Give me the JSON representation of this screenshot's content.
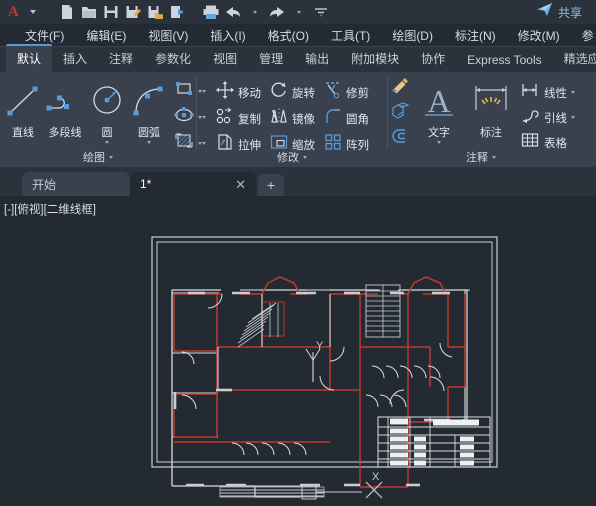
{
  "quick_access": {
    "logo": "A",
    "icons": [
      {
        "name": "app-menu-dropdown",
        "glyph": "caret"
      },
      {
        "name": "new-file-icon",
        "glyph": "page"
      },
      {
        "name": "open-folder-icon",
        "glyph": "folder"
      },
      {
        "name": "save-icon",
        "glyph": "floppy"
      },
      {
        "name": "save-as-icon",
        "glyph": "floppy-pencil"
      },
      {
        "name": "save-copy-icon",
        "glyph": "floppy-folder"
      },
      {
        "name": "export-icon",
        "glyph": "export"
      },
      {
        "name": "print-icon",
        "glyph": "printer"
      },
      {
        "name": "undo-icon",
        "glyph": "arrow-left"
      },
      {
        "name": "undo-dropdown-icon",
        "glyph": "caret"
      },
      {
        "name": "redo-icon",
        "glyph": "arrow-right"
      },
      {
        "name": "redo-dropdown-icon",
        "glyph": "caret"
      },
      {
        "name": "customize-qat-icon",
        "glyph": "caret-wide"
      }
    ],
    "share_label": "共享",
    "share_icon": "send-plane-icon"
  },
  "menubar": {
    "items": [
      {
        "label": "文件(F)",
        "name": "menu-file"
      },
      {
        "label": "编辑(E)",
        "name": "menu-edit"
      },
      {
        "label": "视图(V)",
        "name": "menu-view"
      },
      {
        "label": "插入(I)",
        "name": "menu-insert"
      },
      {
        "label": "格式(O)",
        "name": "menu-format"
      },
      {
        "label": "工具(T)",
        "name": "menu-tools"
      },
      {
        "label": "绘图(D)",
        "name": "menu-draw"
      },
      {
        "label": "标注(N)",
        "name": "menu-dimension"
      },
      {
        "label": "修改(M)",
        "name": "menu-modify"
      },
      {
        "label": "参",
        "name": "menu-parametric-truncated"
      }
    ]
  },
  "ribbon_tabs": {
    "items": [
      {
        "label": "默认",
        "name": "ribbon-tab-home",
        "active": true
      },
      {
        "label": "插入",
        "name": "ribbon-tab-insert",
        "active": false
      },
      {
        "label": "注释",
        "name": "ribbon-tab-annotate",
        "active": false
      },
      {
        "label": "参数化",
        "name": "ribbon-tab-parametric",
        "active": false
      },
      {
        "label": "视图",
        "name": "ribbon-tab-view",
        "active": false
      },
      {
        "label": "管理",
        "name": "ribbon-tab-manage",
        "active": false
      },
      {
        "label": "输出",
        "name": "ribbon-tab-output",
        "active": false
      },
      {
        "label": "附加模块",
        "name": "ribbon-tab-addins",
        "active": false
      },
      {
        "label": "协作",
        "name": "ribbon-tab-collaborate",
        "active": false
      },
      {
        "label": "Express Tools",
        "name": "ribbon-tab-express-tools",
        "active": false
      },
      {
        "label": "精选应用",
        "name": "ribbon-tab-featured-apps",
        "active": false
      }
    ]
  },
  "ribbon": {
    "draw_panel": {
      "title": "绘图",
      "big_buttons": [
        {
          "label": "直线",
          "name": "line-tool",
          "icon": "line-icon",
          "has_caret": false
        },
        {
          "label": "多段线",
          "name": "polyline-tool",
          "icon": "polyline-icon",
          "has_caret": false
        },
        {
          "label": "圆",
          "name": "circle-tool",
          "icon": "circle-icon",
          "has_caret": true
        },
        {
          "label": "圆弧",
          "name": "arc-tool",
          "icon": "arc-icon",
          "has_caret": true
        }
      ],
      "small_buttons": [
        {
          "name": "rectangle-tool",
          "icon": "rectangle-icon"
        },
        {
          "name": "ellipse-tool",
          "icon": "ellipse-icon"
        },
        {
          "name": "hatch-tool",
          "icon": "hatch-icon"
        }
      ]
    },
    "modify_panel": {
      "title": "修改",
      "buttons": [
        {
          "label": "移动",
          "name": "move-tool",
          "icon": "move-icon"
        },
        {
          "label": "旋转",
          "name": "rotate-tool",
          "icon": "rotate-icon"
        },
        {
          "label": "修剪",
          "name": "trim-tool",
          "icon": "trim-icon",
          "has_caret": true
        },
        {
          "label": "复制",
          "name": "copy-tool",
          "icon": "copy-icon"
        },
        {
          "label": "镜像",
          "name": "mirror-tool",
          "icon": "mirror-icon"
        },
        {
          "label": "圆角",
          "name": "fillet-tool",
          "icon": "fillet-icon",
          "has_caret": true
        },
        {
          "label": "拉伸",
          "name": "stretch-tool",
          "icon": "stretch-icon"
        },
        {
          "label": "缩放",
          "name": "scale-tool",
          "icon": "scale-icon"
        },
        {
          "label": "阵列",
          "name": "array-tool",
          "icon": "array-icon",
          "has_caret": true
        }
      ],
      "side_buttons": [
        {
          "name": "match-properties-tool",
          "icon": "paintbrush-icon"
        },
        {
          "name": "solid-edit-tool",
          "icon": "cube-icon"
        },
        {
          "name": "offset-tool",
          "icon": "offset-icon"
        }
      ]
    },
    "annotation_panel": {
      "title": "注释",
      "big_buttons": [
        {
          "label": "文字",
          "name": "text-tool",
          "icon": "text-A-icon",
          "has_caret": true
        },
        {
          "label": "标注",
          "name": "dimension-tool",
          "icon": "dimension-icon",
          "has_caret": false
        }
      ],
      "small_buttons": [
        {
          "label": "线性",
          "name": "linear-dimension-tool",
          "icon": "linear-dim-icon",
          "has_caret": true
        },
        {
          "label": "引线",
          "name": "leader-tool",
          "icon": "leader-icon",
          "has_caret": true
        },
        {
          "label": "表格",
          "name": "table-tool",
          "icon": "table-icon",
          "has_caret": false
        }
      ]
    }
  },
  "document_tabs": {
    "tabs": [
      {
        "label": "开始",
        "name": "doc-tab-start",
        "active": false,
        "closable": false
      },
      {
        "label": "1*",
        "name": "doc-tab-drawing1",
        "active": true,
        "closable": true
      }
    ],
    "close_glyph": "✕",
    "new_tab_glyph": "+",
    "new_tab_name": "new-drawing-tab"
  },
  "viewport": {
    "label": "[-][俯视][二维线框]",
    "ucs": {
      "x_label": "X",
      "y_label": "Y"
    }
  },
  "colors": {
    "accent": "#5b9bd5",
    "wall_red": "#c0392b",
    "line_white": "#d9dde3",
    "canvas_bg": "#232a32",
    "ribbon_bg": "#39414e",
    "titlebar_bg": "#2b323c",
    "share_blue": "#8ec2ee"
  }
}
